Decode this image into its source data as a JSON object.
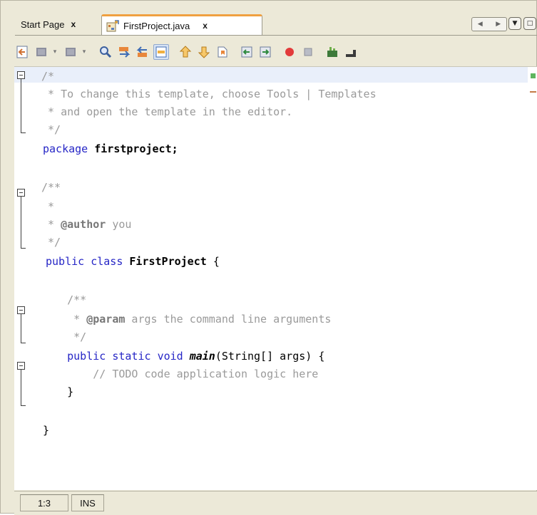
{
  "tabs": [
    {
      "label": "Start Page",
      "close": "x",
      "active": false
    },
    {
      "label": "FirstProject.java",
      "close": "x",
      "active": true
    }
  ],
  "tab_controls": {
    "left_arrow": "◀",
    "right_arrow": "▶",
    "menu_glyph": "▼",
    "maximize_glyph": "□"
  },
  "toolbar": {
    "icons": [
      "last-edit-icon",
      "back-icon",
      "forward-icon",
      "find-icon",
      "find-previous-icon",
      "find-next-icon",
      "toggle-highlight-icon",
      "previous-bookmark-icon",
      "next-bookmark-icon",
      "toggle-bookmark-icon",
      "shift-left-icon",
      "shift-right-icon",
      "start-macro-icon",
      "stop-macro-icon",
      "run-icon",
      "stop-icon"
    ],
    "dropdown_glyph": "▾"
  },
  "editor": {
    "lines": [
      [
        {
          "t": "/*",
          "c": "cm"
        }
      ],
      [
        {
          "t": " * To change this template, choose Tools | Templates",
          "c": "cm"
        }
      ],
      [
        {
          "t": " * and open the template in the editor.",
          "c": "cm"
        }
      ],
      [
        {
          "t": " */",
          "c": "cm"
        }
      ],
      [
        {
          "t": "package",
          "c": "kw"
        },
        {
          "t": " firstproject;",
          "c": "id"
        }
      ],
      [
        {
          "t": "",
          "c": "plain"
        }
      ],
      [
        {
          "t": "/**",
          "c": "cm"
        }
      ],
      [
        {
          "t": " *",
          "c": "cm"
        }
      ],
      [
        {
          "t": " * ",
          "c": "cm"
        },
        {
          "t": "@author",
          "c": "tag"
        },
        {
          "t": " you",
          "c": "cm"
        }
      ],
      [
        {
          "t": " */",
          "c": "cm"
        }
      ],
      [
        {
          "t": "public",
          "c": "kw"
        },
        {
          "t": " ",
          "c": "plain"
        },
        {
          "t": "class",
          "c": "kw"
        },
        {
          "t": " FirstProject ",
          "c": "id"
        },
        {
          "t": "{",
          "c": "plain"
        }
      ],
      [
        {
          "t": "",
          "c": "plain"
        }
      ],
      [
        {
          "t": "    /**",
          "c": "cm"
        }
      ],
      [
        {
          "t": "     * ",
          "c": "cm"
        },
        {
          "t": "@param",
          "c": "tag"
        },
        {
          "t": " args the command line arguments",
          "c": "cm"
        }
      ],
      [
        {
          "t": "     */",
          "c": "cm"
        }
      ],
      [
        {
          "t": "    public",
          "c": "kw"
        },
        {
          "t": " ",
          "c": "plain"
        },
        {
          "t": "static",
          "c": "kw"
        },
        {
          "t": " ",
          "c": "plain"
        },
        {
          "t": "void",
          "c": "kw"
        },
        {
          "t": " ",
          "c": "plain"
        },
        {
          "t": "main",
          "c": "it"
        },
        {
          "t": "(String[] args) {",
          "c": "plain"
        }
      ],
      [
        {
          "t": "        // TODO code application logic here",
          "c": "cm"
        }
      ],
      [
        {
          "t": "    }",
          "c": "plain"
        }
      ],
      [
        {
          "t": "",
          "c": "plain"
        }
      ],
      [
        {
          "t": "}",
          "c": "plain"
        }
      ]
    ]
  },
  "status": {
    "position": "1:3",
    "mode": "INS"
  },
  "colors": {
    "keyword": "#2626c6",
    "comment": "#9a9a9a",
    "current_line": "#e9effa",
    "tab_accent": "#f0a040"
  }
}
